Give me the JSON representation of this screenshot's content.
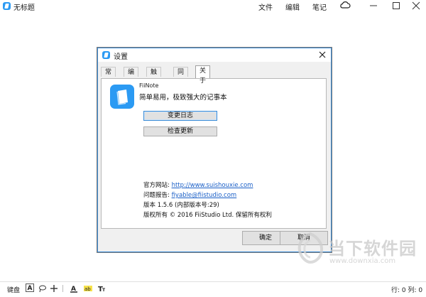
{
  "window": {
    "title": "无标题",
    "menus": [
      "文件",
      "编辑",
      "笔记"
    ],
    "icons": [
      "cloud-icon",
      "minimize-icon",
      "maximize-icon",
      "close-icon"
    ]
  },
  "dialog": {
    "title": "设置",
    "tabs": [
      "常规",
      "编辑",
      "触控笔",
      "同步",
      "关于"
    ],
    "active_tab": "关于",
    "about": {
      "app_name": "FiiNote",
      "app_desc": "简单易用，极致强大的记事本",
      "changelog_button": "变更日志",
      "update_button": "检查更新",
      "website_label": "官方网站:",
      "website_url": "http://www.suishouxie.com",
      "report_label": "问题报告:",
      "report_email": "fiyable@fiistudio.com",
      "version": "版本 1.5.6 (内部版本号:29)",
      "copyright": "版权所有 © 2016 FiiStudio Ltd. 保留所有权利"
    },
    "ok_button": "确定",
    "cancel_button": "取消"
  },
  "statusbar": {
    "keyboard_label": "键盘",
    "font_box": "A",
    "position": "行: 0 列: 0"
  },
  "watermark": {
    "text": "当下软件园",
    "url": "www.downxia.com"
  },
  "colors": {
    "accent": "#2b9af3",
    "link": "#1a5fc7",
    "dialog_bg": "#f0f0f0"
  }
}
